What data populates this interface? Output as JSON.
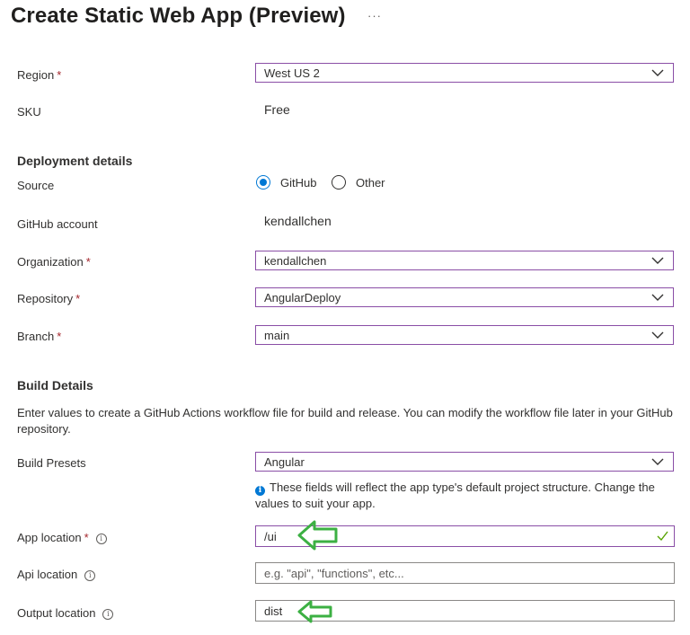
{
  "page": {
    "title": "Create Static Web App (Preview)",
    "more_label": "···"
  },
  "fields": {
    "region": {
      "label": "Region",
      "required_mark": "*",
      "value": "West US 2"
    },
    "sku": {
      "label": "SKU",
      "value": "Free"
    }
  },
  "deployment": {
    "heading": "Deployment details",
    "source": {
      "label": "Source",
      "options": [
        {
          "label": "GitHub",
          "selected": true
        },
        {
          "label": "Other",
          "selected": false
        }
      ]
    },
    "github_account": {
      "label": "GitHub account",
      "value": "kendallchen"
    },
    "organization": {
      "label": "Organization",
      "required_mark": "*",
      "value": "kendallchen"
    },
    "repository": {
      "label": "Repository",
      "required_mark": "*",
      "value": "AngularDeploy"
    },
    "branch": {
      "label": "Branch",
      "required_mark": "*",
      "value": "main"
    }
  },
  "build": {
    "heading": "Build Details",
    "description": "Enter values to create a GitHub Actions workflow file for build and release. You can modify the workflow file later in your GitHub repository.",
    "presets": {
      "label": "Build Presets",
      "value": "Angular"
    },
    "note": "These fields will reflect the app type's default project structure. Change the values to suit your app.",
    "app_location": {
      "label": "App location",
      "required_mark": "*",
      "value": "/ui"
    },
    "api_location": {
      "label": "Api location",
      "value": "",
      "placeholder": "e.g. \"api\", \"functions\", etc..."
    },
    "output_location": {
      "label": "Output location",
      "value": "dist"
    }
  },
  "colors": {
    "accent": "#0078d4",
    "focus_border": "#8a4ea6",
    "required": "#a4262c",
    "valid_check": "#57a300",
    "annotation_arrow": "#3cb043"
  },
  "icons": [
    "more-icon",
    "chevron-down-icon",
    "info-icon",
    "checkmark-icon",
    "annotation-arrow-icon"
  ]
}
